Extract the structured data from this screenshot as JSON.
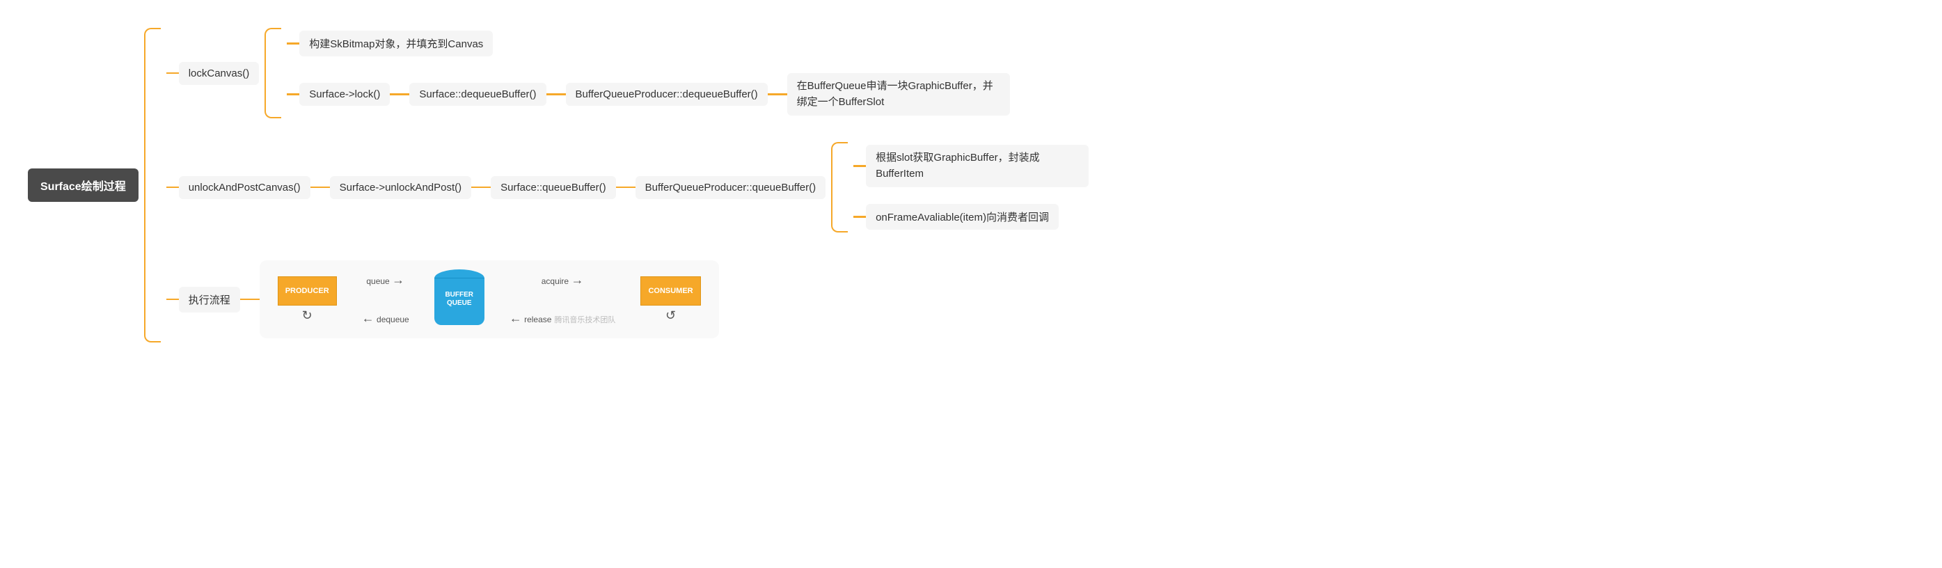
{
  "root": "Surface绘制过程",
  "branches": {
    "lockCanvas": {
      "label": "lockCanvas()",
      "children": {
        "skbitmap": "构建SkBitmap对象，并填充到Canvas",
        "surfaceLock": "Surface->lock()",
        "dequeueBuffer": "Surface::dequeueBuffer()",
        "bqpDequeue": "BufferQueueProducer::dequeueBuffer()",
        "allocBuf": "在BufferQueue申请一块GraphicBuffer，并绑定一个BufferSlot"
      }
    },
    "unlockPost": {
      "label": "unlockAndPostCanvas()",
      "chain": {
        "unlockAndPost": "Surface->unlockAndPost()",
        "queueBuffer": "Surface::queueBuffer()",
        "bqpQueue": "BufferQueueProducer::queueBuffer()"
      },
      "leaves": {
        "wrapBufferItem": "根据slot获取GraphicBuffer，封装成BufferItem",
        "onFrame": "onFrameAvaliable(item)向消费者回调"
      }
    },
    "flow": {
      "label": "执行流程",
      "diagram": {
        "producer": "PRODUCER",
        "consumer": "CONSUMER",
        "bufferQueue": "BUFFER QUEUE",
        "queue": "queue",
        "dequeue": "dequeue",
        "acquire": "acquire",
        "release": "release",
        "watermark": "腾讯音乐技术团队"
      }
    }
  }
}
